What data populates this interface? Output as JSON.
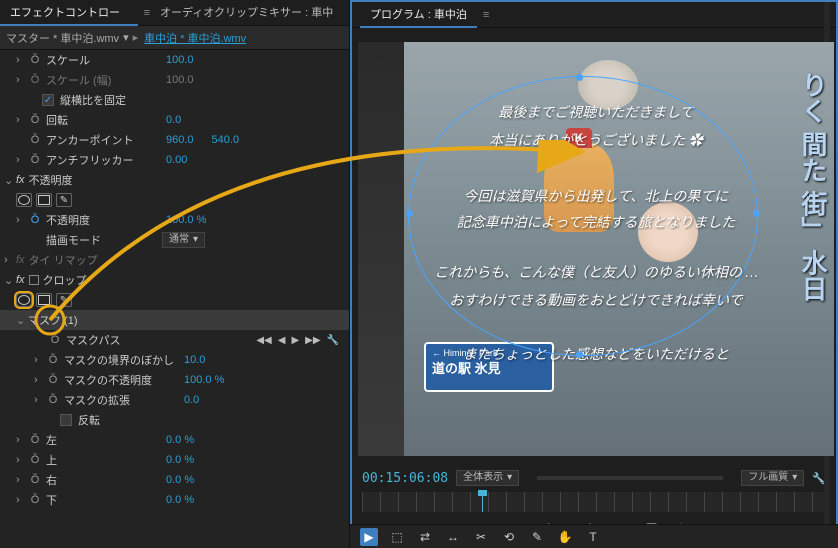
{
  "left": {
    "tabs": {
      "effect_controls": "エフェクトコントロール",
      "audio_mixer": "オーディオクリップミキサー  : 車中泊"
    },
    "master": {
      "prefix": "マスター * 車中泊.wmv",
      "link": "車中泊 * 車中泊.wmv"
    },
    "props": {
      "scale": {
        "label": "スケール",
        "value": "100.0"
      },
      "scale_w": {
        "label": "スケール (幅)",
        "value": "100.0"
      },
      "uniform": {
        "label": "縦横比を固定"
      },
      "rotation": {
        "label": "回転",
        "value": "0.0"
      },
      "anchor": {
        "label": "アンカーポイント",
        "x": "960.0",
        "y": "540.0"
      },
      "antiflicker": {
        "label": "アンチフリッカー",
        "value": "0.00"
      },
      "opacity_section": "不透明度",
      "opacity": {
        "label": "不透明度",
        "value": "100.0 %"
      },
      "blend": {
        "label": "描画モード",
        "value": "通常"
      },
      "timeremap": "タイ   リマップ",
      "crop_section": "クロップ",
      "mask_section": "マスク (1)",
      "mask_path": "マスクパス",
      "mask_feather": {
        "label": "マスクの境界のぼかし",
        "value": "10.0"
      },
      "mask_opacity": {
        "label": "マスクの不透明度",
        "value": "100.0 %"
      },
      "mask_expand": {
        "label": "マスクの拡張",
        "value": "0.0"
      },
      "mask_invert": "反転",
      "crop_l": {
        "label": "左",
        "value": "0.0 %"
      },
      "crop_t": {
        "label": "上",
        "value": "0.0 %"
      },
      "crop_r": {
        "label": "右",
        "value": "0.0 %"
      },
      "crop_b": {
        "label": "下",
        "value": "0.0 %"
      }
    }
  },
  "right": {
    "program_label": "プログラム : 車中泊",
    "timecode": "00:15:06:08",
    "fit": "全体表示",
    "quality": "フル画質",
    "captions": {
      "l1": "最後までご視聴いただきまして",
      "l2": "本当にありがとうございました ✿",
      "l3": "今回は滋賀県から出発して、北上の果てに",
      "l4": "記念車中泊によって完結する旅となりました",
      "l5": "これからも、こんな僕（と友人）のゆるい休相の …",
      "l6": "おすわけできる動画をおとどけできれば幸いで",
      "l7": "またちょっとした感想などをいただけると"
    },
    "sign": {
      "line1": "← Himinoe Park",
      "line2": "道の駅 氷見"
    },
    "jp_vertical": "りく 間た 街」 水日"
  },
  "toolstrip": [
    "selection",
    "track-select",
    "ripple",
    "rolling",
    "rate",
    "razor",
    "slip",
    "slide",
    "pen",
    "hand",
    "zoom",
    "type"
  ]
}
